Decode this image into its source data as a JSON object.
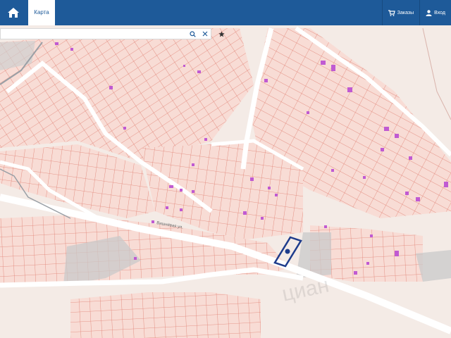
{
  "header": {
    "home_icon": "home-icon",
    "tab_label": "Карта",
    "orders_label": "Заказы",
    "orders_icon": "cart-icon",
    "login_label": "Вход",
    "login_icon": "user-icon"
  },
  "search": {
    "value": "",
    "placeholder": "",
    "search_icon": "search-icon",
    "clear_icon": "close-icon",
    "favorite_icon": "star-icon"
  },
  "map": {
    "street_label": "Вишнёвая ул.",
    "colors": {
      "background": "#f4ebe6",
      "parcel_stroke": "#e07f72",
      "parcel_fill": "#f8dcd5",
      "building": "#c05ad2",
      "road": "#ffffff",
      "selected": "#1e3c8c",
      "grey_area": "#c9c9c9"
    }
  },
  "watermark": "циан"
}
